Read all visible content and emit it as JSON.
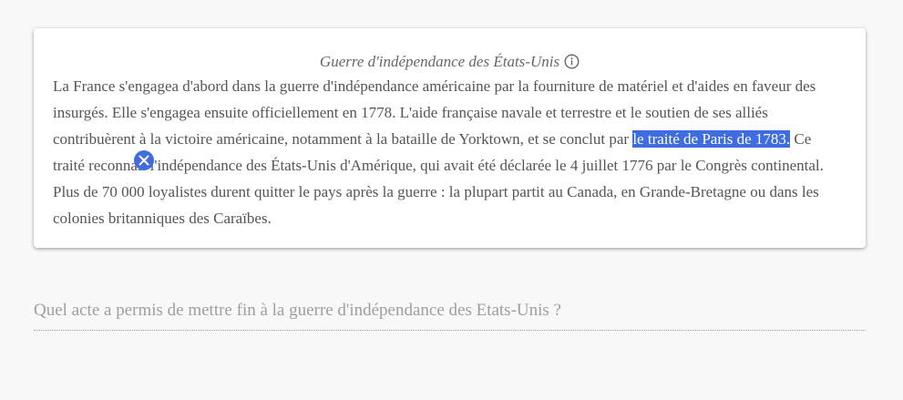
{
  "card": {
    "title": "Guerre d'indépendance des États-Unis",
    "info_icon": "info-circle-icon",
    "passage_before": "La France s'engagea d'abord dans la guerre d'indépendance américaine par la fourniture de matériel et d'aides en faveur des insurgés. Elle s'engagea ensuite officiellement en 1778. L'aide française navale et terrestre et le soutien de ses alliés contribuèrent à la victoire américaine, notamment à la bataille de Yorktown, et se conclut par ",
    "passage_highlight": "le traité de Paris de 1783.",
    "passage_after": " Ce traité reconnaît l'indépendance des États-Unis d'Amérique, qui avait été déclarée le 4 juillet 1776 par le Congrès continental. Plus de 70 000 loyalistes durent quitter le pays après la guerre : la plupart partit au Canada, en Grande-Bretagne ou dans les colonies britanniques des Caraïbes.",
    "clear_icon": "close-icon"
  },
  "question": {
    "text": "Quel acte a permis de mettre fin à la guerre d'indépendance des Etats-Unis ?"
  },
  "colors": {
    "highlight": "#3f6ce1",
    "background": "#f8f8f8",
    "card": "#ffffff"
  }
}
